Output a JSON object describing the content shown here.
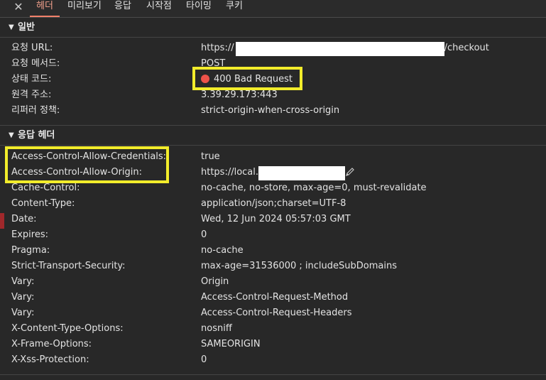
{
  "tabs": [
    "헤더",
    "미리보기",
    "응답",
    "시작점",
    "타이밍",
    "쿠키"
  ],
  "active_tab": "헤더",
  "colors": {
    "highlight": "#f2ec2b",
    "status_error": "#ed5249",
    "active_tab": "#f2a08c"
  },
  "general": {
    "title": "일반",
    "rows": [
      {
        "key": "요청 URL:",
        "value_prefix": "https://",
        "value_suffix": "/checkout"
      },
      {
        "key": "요청 메서드:",
        "value": "POST"
      },
      {
        "key": "상태 코드:",
        "value": "400 Bad Request"
      },
      {
        "key": "원격 주소:",
        "value": "3.39.29.173:443"
      },
      {
        "key": "리퍼러 정책:",
        "value": "strict-origin-when-cross-origin"
      }
    ]
  },
  "response_headers": {
    "title": "응답 헤더",
    "rows": [
      {
        "key": "Access-Control-Allow-Credentials:",
        "value": "true"
      },
      {
        "key": "Access-Control-Allow-Origin:",
        "value": "https://local."
      },
      {
        "key": "Cache-Control:",
        "value": "no-cache, no-store, max-age=0, must-revalidate"
      },
      {
        "key": "Content-Type:",
        "value": "application/json;charset=UTF-8"
      },
      {
        "key": "Date:",
        "value": "Wed, 12 Jun 2024 05:57:03 GMT"
      },
      {
        "key": "Expires:",
        "value": "0"
      },
      {
        "key": "Pragma:",
        "value": "no-cache"
      },
      {
        "key": "Strict-Transport-Security:",
        "value": "max-age=31536000 ; includeSubDomains"
      },
      {
        "key": "Vary:",
        "value": "Origin"
      },
      {
        "key": "Vary:",
        "value": "Access-Control-Request-Method"
      },
      {
        "key": "Vary:",
        "value": "Access-Control-Request-Headers"
      },
      {
        "key": "X-Content-Type-Options:",
        "value": "nosniff"
      },
      {
        "key": "X-Frame-Options:",
        "value": "SAMEORIGIN"
      },
      {
        "key": "X-Xss-Protection:",
        "value": "0"
      }
    ]
  },
  "icons": {
    "close": "close-icon",
    "edit": "pencil-icon",
    "expand": "triangle-down-icon"
  }
}
